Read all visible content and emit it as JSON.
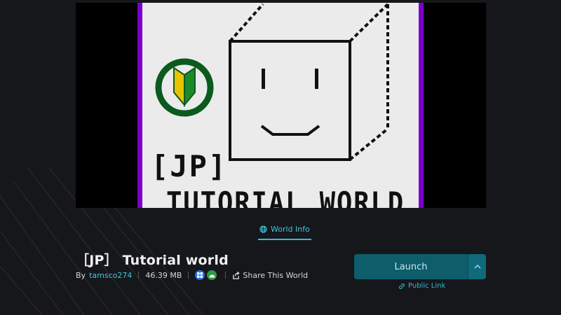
{
  "world": {
    "title": "［JP］ Tutorial world",
    "author_prefix": "By",
    "author": "tamsco274",
    "size": "46.39 MB",
    "share_label": "Share This World"
  },
  "tabs": [
    {
      "label": "World Info",
      "active": true
    }
  ],
  "banner": {
    "line1": "[JP]",
    "line2": "TUTORIAL WORLD",
    "accent_color": "#7b00c8",
    "badge_colors": {
      "ring": "#0b5a1e",
      "leaf_left": "#e8c400",
      "leaf_right": "#1d8a2a"
    }
  },
  "platforms": [
    {
      "name": "windows-icon",
      "color": "#1f6fe0"
    },
    {
      "name": "android-icon",
      "color": "#2d9a45"
    }
  ],
  "actions": {
    "launch_label": "Launch",
    "public_link_label": "Public Link",
    "accent_color": "#0d5d6b"
  }
}
